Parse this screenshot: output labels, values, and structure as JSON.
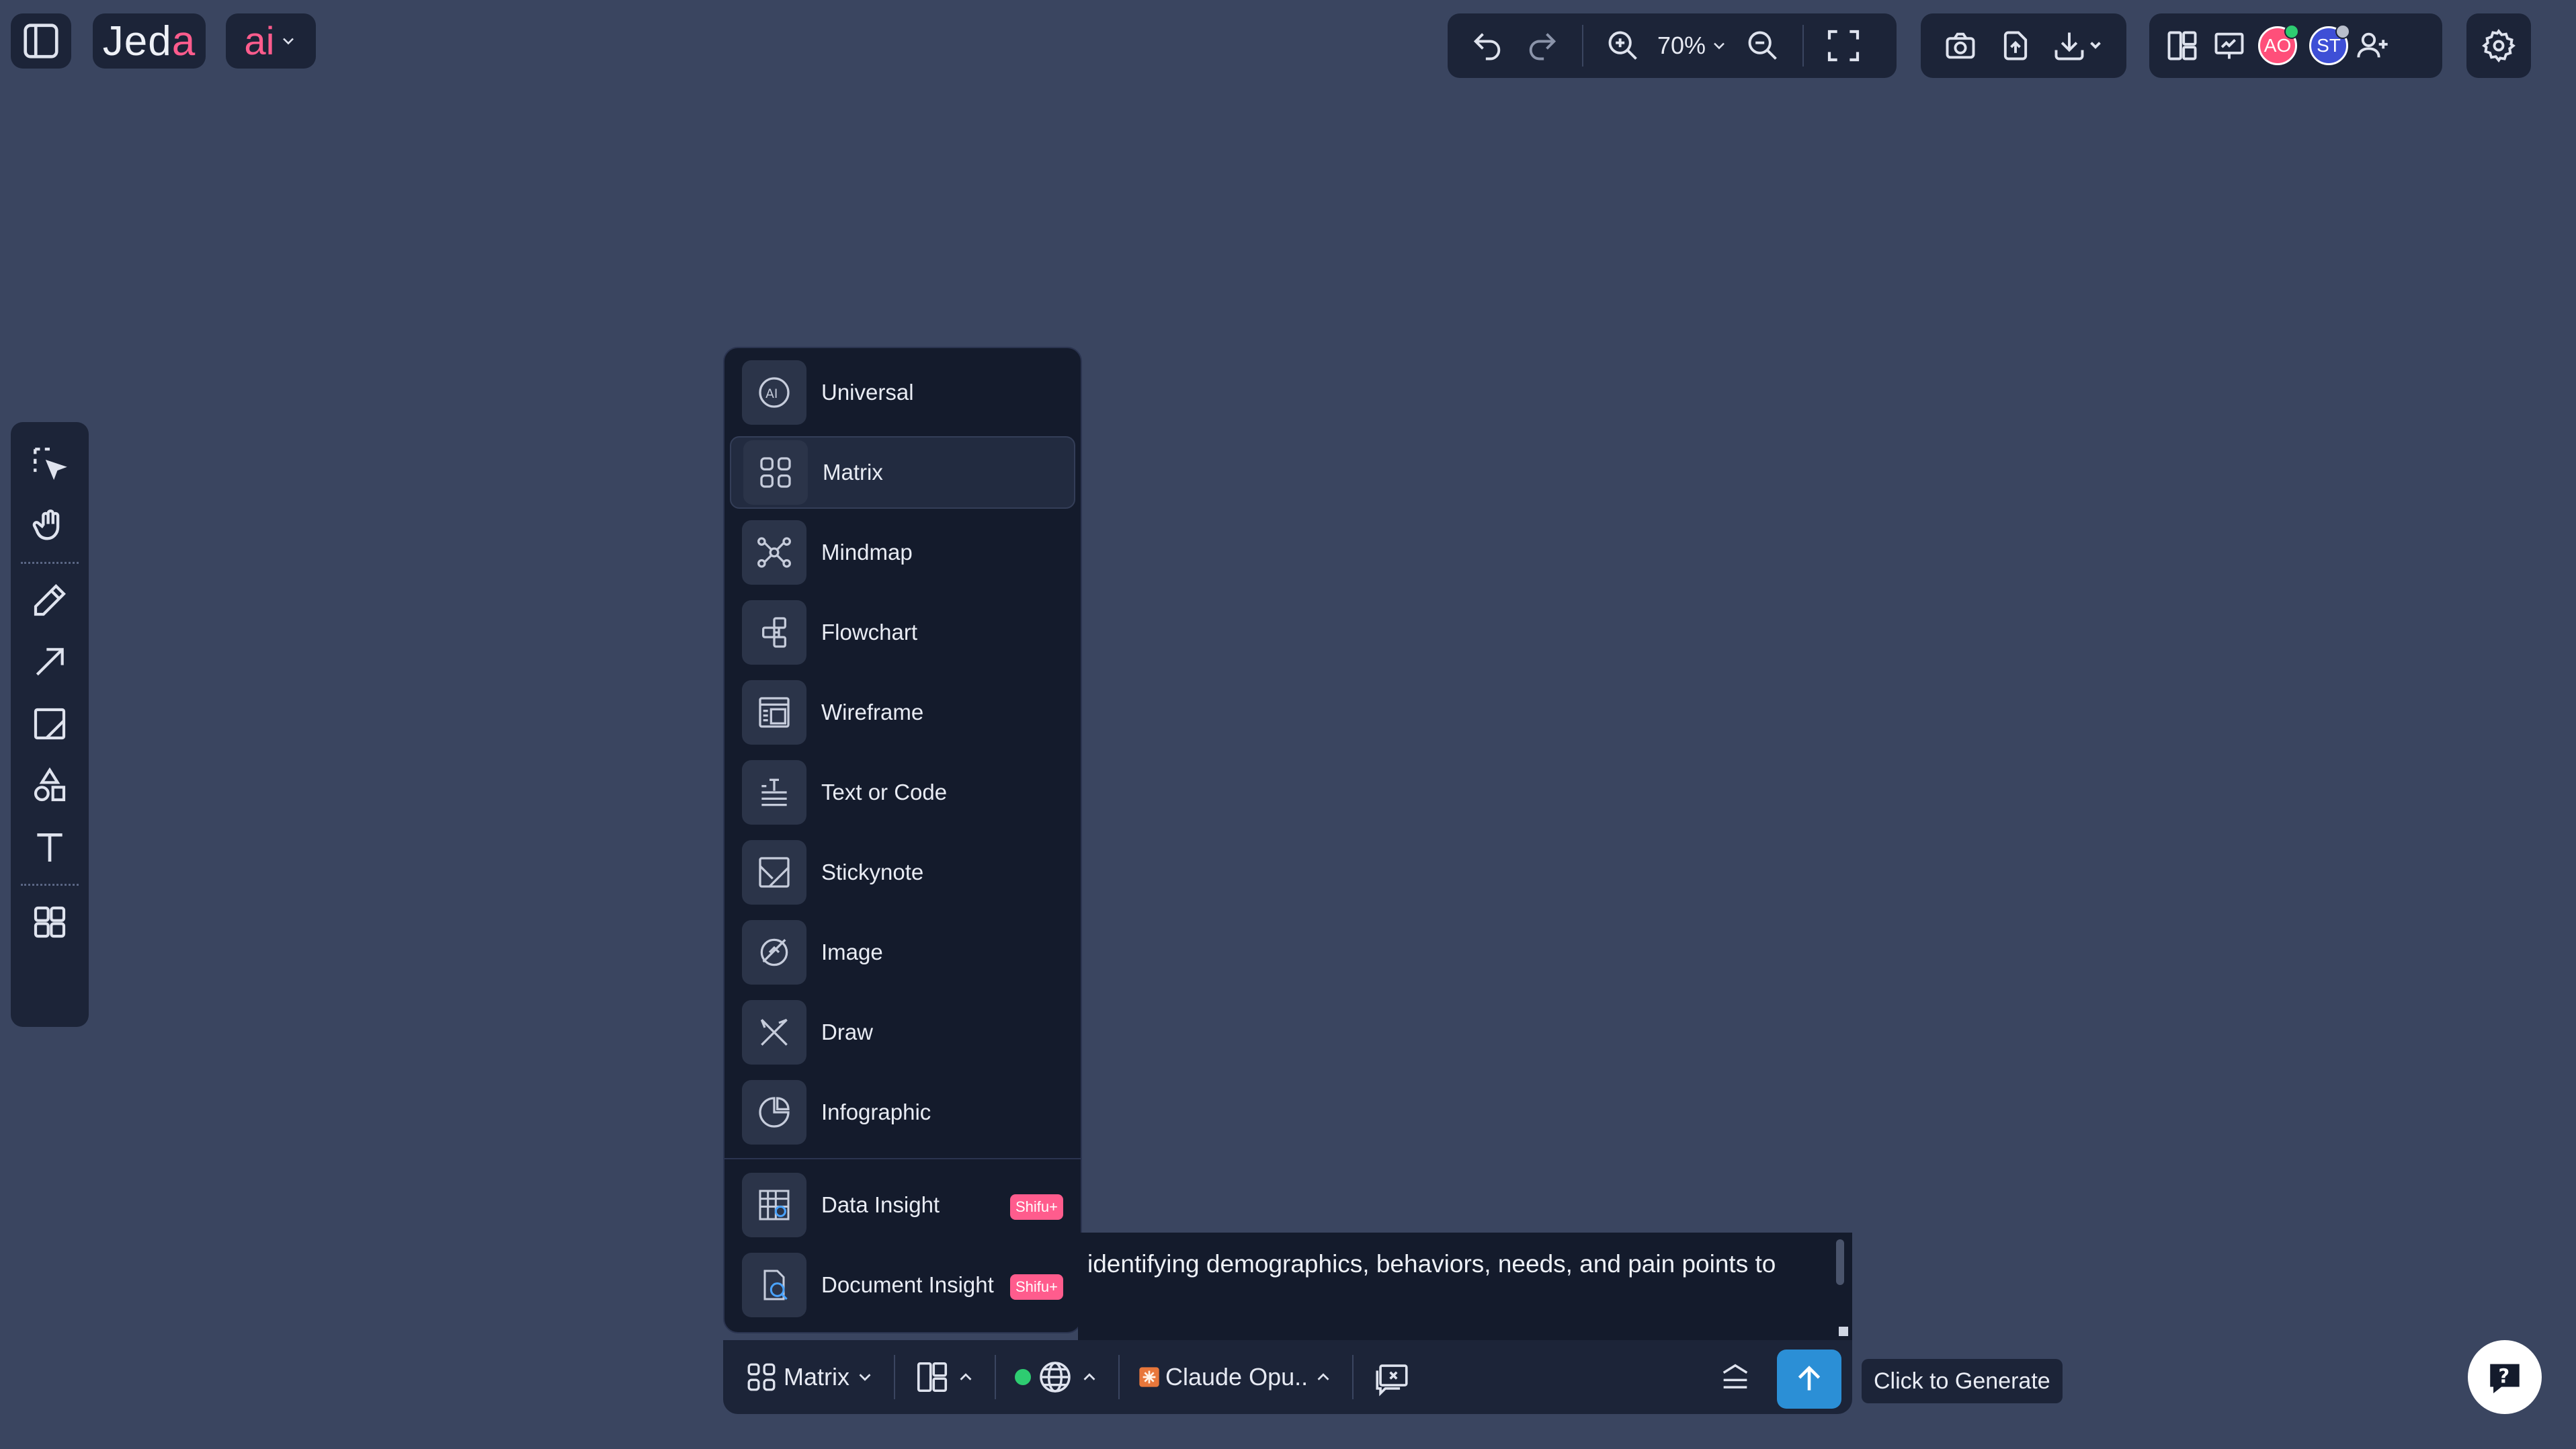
{
  "header": {
    "logo_text_main": "Jed",
    "logo_text_accent": "a",
    "ai_label": "ai",
    "zoom_level": "70%"
  },
  "avatars": [
    {
      "initials": "AO",
      "color": "#ff4f7a",
      "status_color": "#2ecc71"
    },
    {
      "initials": "ST",
      "color": "#3e4fd6",
      "status_color": "#b9bfcc"
    }
  ],
  "left_toolbar": [
    "select-icon",
    "hand-icon",
    "pencil-icon",
    "arrow-icon",
    "sticky-icon",
    "shapes-icon",
    "text-icon",
    "components-icon"
  ],
  "type_menu": {
    "items": [
      {
        "label": "Universal",
        "icon": "ai-circle-icon"
      },
      {
        "label": "Matrix",
        "icon": "grid-icon",
        "selected": true
      },
      {
        "label": "Mindmap",
        "icon": "mindmap-icon"
      },
      {
        "label": "Flowchart",
        "icon": "flowchart-icon"
      },
      {
        "label": "Wireframe",
        "icon": "wireframe-icon"
      },
      {
        "label": "Text or Code",
        "icon": "text-code-icon"
      },
      {
        "label": "Stickynote",
        "icon": "stickynote-icon"
      },
      {
        "label": "Image",
        "icon": "image-icon"
      },
      {
        "label": "Draw",
        "icon": "draw-icon"
      },
      {
        "label": "Infographic",
        "icon": "infographic-icon"
      }
    ],
    "premium_items": [
      {
        "label": "Data Insight",
        "badge": "Shifu+",
        "icon": "data-insight-icon"
      },
      {
        "label": "Document Insight",
        "badge": "Shifu+",
        "icon": "document-insight-icon"
      }
    ]
  },
  "prompt": {
    "text": "identifying demographics, behaviors, needs, and pain points to"
  },
  "bottom_bar": {
    "mode_label": "Matrix",
    "model_label": "Claude Opu..",
    "status_color": "#2ecc71"
  },
  "tooltip": "Click to Generate",
  "colors": {
    "background": "#3a4560",
    "panel": "#1c2438",
    "accent_pink": "#ff5c8d",
    "accent_blue": "#2b8fd6"
  }
}
